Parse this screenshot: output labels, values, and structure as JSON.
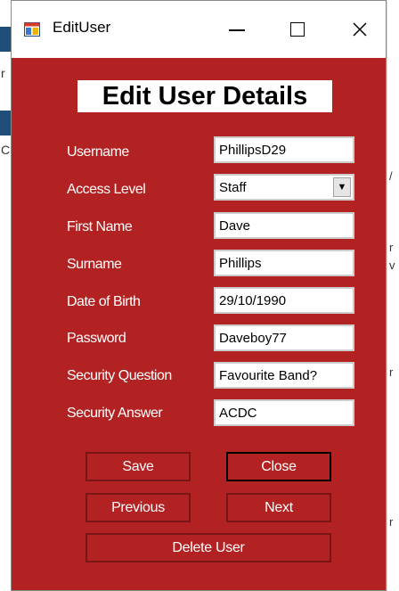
{
  "window": {
    "title": "EditUser"
  },
  "form": {
    "heading": "Edit User Details",
    "fields": {
      "username": {
        "label": "Username",
        "value": "PhillipsD29"
      },
      "access_level": {
        "label": "Access Level",
        "value": "Staff"
      },
      "first_name": {
        "label": "First Name",
        "value": "Dave"
      },
      "surname": {
        "label": "Surname",
        "value": "Phillips"
      },
      "dob": {
        "label": "Date of Birth",
        "value": "29/10/1990"
      },
      "password": {
        "label": "Password",
        "value": "Daveboy77"
      },
      "security_question": {
        "label": "Security Question",
        "value": "Favourite Band?"
      },
      "security_answer": {
        "label": "Security Answer",
        "value": "ACDC"
      }
    }
  },
  "buttons": {
    "save": "Save",
    "close": "Close",
    "previous": "Previous",
    "next": "Next",
    "delete": "Delete User"
  },
  "colors": {
    "form_background": "#b22222",
    "button_border": "#7a1515"
  }
}
